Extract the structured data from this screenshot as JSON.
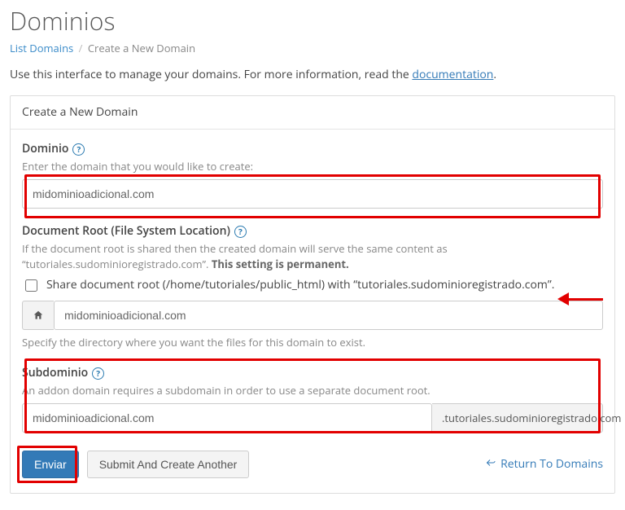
{
  "page": {
    "title": "Dominios",
    "breadcrumb": {
      "list_label": "List Domains",
      "current": "Create a New Domain"
    },
    "intro_prefix": "Use this interface to manage your domains. For more information, read the ",
    "intro_link": "documentation",
    "intro_suffix": "."
  },
  "panel": {
    "heading": "Create a New Domain"
  },
  "domain": {
    "label": "Dominio",
    "hint": "Enter the domain that you would like to create:",
    "value": "midominioadicional.com"
  },
  "docroot": {
    "label": "Document Root (File System Location)",
    "hint_a": "If the document root is shared then the created domain will serve the same content as “tutoriales.sudominioregistrado.com”. ",
    "hint_b": "This setting is permanent.",
    "share_label": "Share document root (/home/tutoriales/public_html) with “tutoriales.sudominioregistrado.com”.",
    "share_checked": false,
    "path_value": "midominioadicional.com",
    "path_hint": "Specify the directory where you want the files for this domain to exist."
  },
  "subdomain": {
    "label": "Subdominio",
    "hint": "An addon domain requires a subdomain in order to use a separate document root.",
    "value": "midominioadicional.com",
    "suffix": ".tutoriales.sudominioregistrado.com"
  },
  "actions": {
    "submit": "Enviar",
    "submit_another": "Submit And Create Another",
    "return": "Return To Domains"
  }
}
